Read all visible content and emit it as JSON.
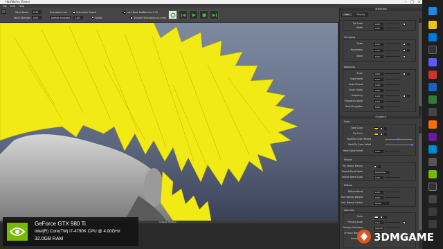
{
  "window": {
    "title": "HairWorks Viewer"
  },
  "menu": {
    "items": [
      "File",
      "Edit",
      "Help"
    ]
  },
  "toolbar": {
    "wind_noise_label": "Wind Noise",
    "wind_noise_value": "0.30",
    "wind_strength_label": "Wind Strength",
    "wind_strength_value": "0.00",
    "animation_list_label": "Animation List",
    "animation_list_value": "Default Animatio",
    "animation_speed_label": "Animation Speed",
    "animation_speed_value": "1.00",
    "toolkit_label": "Toolkit",
    "lock_root_bone_label": "Lock Root Bone",
    "preview_label": "Preview 1.00",
    "smooth_label": "Smooth Simulation on Jump"
  },
  "attributes": {
    "header": "Attributes",
    "tabs": [
      "Hair",
      "Display"
    ],
    "groups": [
      {
        "rows": [
          {
            "label": "Tip Scale",
            "value": "0.00"
          },
          {
            "label": "Width",
            "value": "0.00"
          }
        ]
      },
      {
        "title": "Clumping",
        "rows": [
          {
            "label": "Scale",
            "value": "0.00"
          },
          {
            "label": "Roundness",
            "value": "1.00"
          },
          {
            "label": "Noise",
            "value": "0.00"
          }
        ]
      },
      {
        "title": "Waviness",
        "rows": [
          {
            "label": "Scale",
            "value": "0.00"
          },
          {
            "label": "Scale Noise",
            "value": "0.00"
          },
          {
            "label": "Scale Strand",
            "value": "1.00"
          },
          {
            "label": "Scale Clump",
            "value": "0.00"
          },
          {
            "label": "Frequency",
            "value": "1.00"
          },
          {
            "label": "Frequency Noise",
            "value": "0.00"
          },
          {
            "label": "Root Straighten",
            "value": "0.00"
          }
        ]
      }
    ],
    "graphics_header": "Graphics",
    "color_group": {
      "title": "Color",
      "rows": [
        {
          "label": "Root Color",
          "kind": "color",
          "color": "#f2d21b"
        },
        {
          "label": "Tip Color",
          "kind": "color",
          "color": "#f2d21b"
        },
        {
          "label": "Root/Tip Color Weight",
          "kind": "slider"
        },
        {
          "label": "Root/Tip Color Falloff",
          "kind": "slider"
        },
        {
          "label": "Base Alpha Falloff",
          "kind": "value",
          "value": "0.00"
        }
      ]
    },
    "strand_group": {
      "title": "Strand",
      "rows": [
        {
          "label": "Per Strand Texture",
          "kind": "icon"
        },
        {
          "label": "Strand Blend Mode",
          "kind": "combo",
          "value": "Overwrite"
        },
        {
          "label": "Strand Blend Scale",
          "kind": "value",
          "value": "1.00"
        }
      ]
    },
    "diffuse_group": {
      "title": "Diffuse",
      "rows": [
        {
          "label": "Diffuse Blend",
          "value": "0.50"
        },
        {
          "label": "Hair Normal Weight",
          "value": "0.00"
        },
        {
          "label": "Hair Normal Center",
          "kind": "combo",
          "value": "Spine"
        }
      ]
    },
    "specular_group": {
      "title": "Specular",
      "rows": [
        {
          "label": "Color",
          "kind": "color",
          "color": "#ffffff"
        },
        {
          "label": "Primary Scale",
          "value": "0.10"
        },
        {
          "label": "Primary Shininess",
          "value": "100.00"
        },
        {
          "label": "Primary Breakup",
          "value": "0.00"
        },
        {
          "label": "Secondary",
          "value": "0.05"
        }
      ]
    }
  },
  "output": {
    "label": "Output Window"
  },
  "gpu": {
    "line1": "GeForce GTX 980 Ti",
    "line2": "Intel(R) Core(TM) i7-4790K CPU @ 4.00GHz",
    "line3": "32.0GB RAM"
  },
  "watermark": {
    "text": "3DMGAME"
  },
  "colors": {
    "hair": "#f2ea14",
    "accent": "#3a86d6",
    "nvidia_green": "#76b900"
  }
}
